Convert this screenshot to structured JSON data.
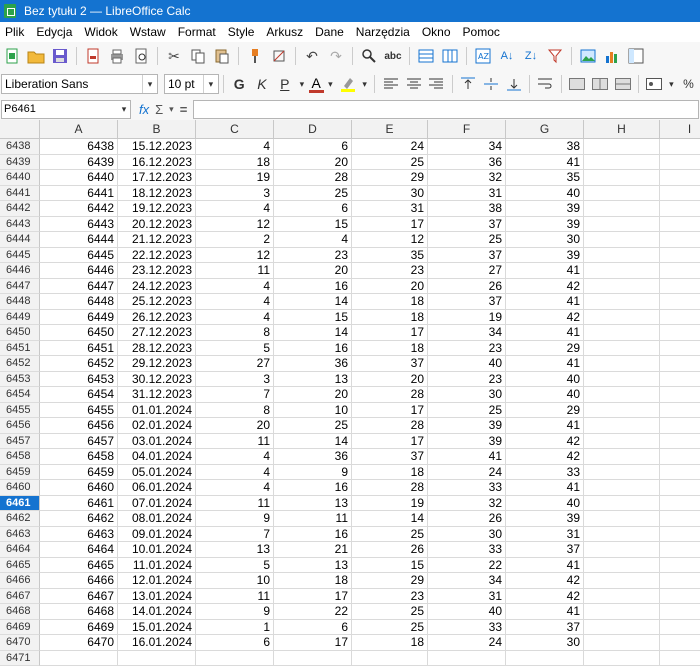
{
  "window": {
    "title": "Bez tytułu 2 — LibreOffice Calc"
  },
  "menu": [
    "Plik",
    "Edycja",
    "Widok",
    "Wstaw",
    "Format",
    "Style",
    "Arkusz",
    "Dane",
    "Narzędzia",
    "Okno",
    "Pomoc"
  ],
  "format": {
    "font_name": "Liberation Sans",
    "font_size": "10 pt",
    "bold": "G",
    "italic": "K",
    "underline": "P",
    "font_color_letter": "A"
  },
  "formula": {
    "cell_ref": "P6461",
    "fx": "fx",
    "sigma": "Σ",
    "equals": "=",
    "content": ""
  },
  "columns": [
    "A",
    "B",
    "C",
    "D",
    "E",
    "F",
    "G",
    "H",
    "I"
  ],
  "active_row": "6461",
  "rows": [
    {
      "n": "6438",
      "a": "6438",
      "b": "15.12.2023",
      "c": "4",
      "d": "6",
      "e": "24",
      "f": "34",
      "g": "38"
    },
    {
      "n": "6439",
      "a": "6439",
      "b": "16.12.2023",
      "c": "18",
      "d": "20",
      "e": "25",
      "f": "36",
      "g": "41"
    },
    {
      "n": "6440",
      "a": "6440",
      "b": "17.12.2023",
      "c": "19",
      "d": "28",
      "e": "29",
      "f": "32",
      "g": "35"
    },
    {
      "n": "6441",
      "a": "6441",
      "b": "18.12.2023",
      "c": "3",
      "d": "25",
      "e": "30",
      "f": "31",
      "g": "40"
    },
    {
      "n": "6442",
      "a": "6442",
      "b": "19.12.2023",
      "c": "4",
      "d": "6",
      "e": "31",
      "f": "38",
      "g": "39"
    },
    {
      "n": "6443",
      "a": "6443",
      "b": "20.12.2023",
      "c": "12",
      "d": "15",
      "e": "17",
      "f": "37",
      "g": "39"
    },
    {
      "n": "6444",
      "a": "6444",
      "b": "21.12.2023",
      "c": "2",
      "d": "4",
      "e": "12",
      "f": "25",
      "g": "30"
    },
    {
      "n": "6445",
      "a": "6445",
      "b": "22.12.2023",
      "c": "12",
      "d": "23",
      "e": "35",
      "f": "37",
      "g": "39"
    },
    {
      "n": "6446",
      "a": "6446",
      "b": "23.12.2023",
      "c": "11",
      "d": "20",
      "e": "23",
      "f": "27",
      "g": "41"
    },
    {
      "n": "6447",
      "a": "6447",
      "b": "24.12.2023",
      "c": "4",
      "d": "16",
      "e": "20",
      "f": "26",
      "g": "42"
    },
    {
      "n": "6448",
      "a": "6448",
      "b": "25.12.2023",
      "c": "4",
      "d": "14",
      "e": "18",
      "f": "37",
      "g": "41"
    },
    {
      "n": "6449",
      "a": "6449",
      "b": "26.12.2023",
      "c": "4",
      "d": "15",
      "e": "18",
      "f": "19",
      "g": "42"
    },
    {
      "n": "6450",
      "a": "6450",
      "b": "27.12.2023",
      "c": "8",
      "d": "14",
      "e": "17",
      "f": "34",
      "g": "41"
    },
    {
      "n": "6451",
      "a": "6451",
      "b": "28.12.2023",
      "c": "5",
      "d": "16",
      "e": "18",
      "f": "23",
      "g": "29"
    },
    {
      "n": "6452",
      "a": "6452",
      "b": "29.12.2023",
      "c": "27",
      "d": "36",
      "e": "37",
      "f": "40",
      "g": "41"
    },
    {
      "n": "6453",
      "a": "6453",
      "b": "30.12.2023",
      "c": "3",
      "d": "13",
      "e": "20",
      "f": "23",
      "g": "40"
    },
    {
      "n": "6454",
      "a": "6454",
      "b": "31.12.2023",
      "c": "7",
      "d": "20",
      "e": "28",
      "f": "30",
      "g": "40"
    },
    {
      "n": "6455",
      "a": "6455",
      "b": "01.01.2024",
      "c": "8",
      "d": "10",
      "e": "17",
      "f": "25",
      "g": "29"
    },
    {
      "n": "6456",
      "a": "6456",
      "b": "02.01.2024",
      "c": "20",
      "d": "25",
      "e": "28",
      "f": "39",
      "g": "41"
    },
    {
      "n": "6457",
      "a": "6457",
      "b": "03.01.2024",
      "c": "11",
      "d": "14",
      "e": "17",
      "f": "39",
      "g": "42"
    },
    {
      "n": "6458",
      "a": "6458",
      "b": "04.01.2024",
      "c": "4",
      "d": "36",
      "e": "37",
      "f": "41",
      "g": "42"
    },
    {
      "n": "6459",
      "a": "6459",
      "b": "05.01.2024",
      "c": "4",
      "d": "9",
      "e": "18",
      "f": "24",
      "g": "33"
    },
    {
      "n": "6460",
      "a": "6460",
      "b": "06.01.2024",
      "c": "4",
      "d": "16",
      "e": "28",
      "f": "33",
      "g": "41"
    },
    {
      "n": "6461",
      "a": "6461",
      "b": "07.01.2024",
      "c": "11",
      "d": "13",
      "e": "19",
      "f": "32",
      "g": "40"
    },
    {
      "n": "6462",
      "a": "6462",
      "b": "08.01.2024",
      "c": "9",
      "d": "11",
      "e": "14",
      "f": "26",
      "g": "39"
    },
    {
      "n": "6463",
      "a": "6463",
      "b": "09.01.2024",
      "c": "7",
      "d": "16",
      "e": "25",
      "f": "30",
      "g": "31"
    },
    {
      "n": "6464",
      "a": "6464",
      "b": "10.01.2024",
      "c": "13",
      "d": "21",
      "e": "26",
      "f": "33",
      "g": "37"
    },
    {
      "n": "6465",
      "a": "6465",
      "b": "11.01.2024",
      "c": "5",
      "d": "13",
      "e": "15",
      "f": "22",
      "g": "41"
    },
    {
      "n": "6466",
      "a": "6466",
      "b": "12.01.2024",
      "c": "10",
      "d": "18",
      "e": "29",
      "f": "34",
      "g": "42"
    },
    {
      "n": "6467",
      "a": "6467",
      "b": "13.01.2024",
      "c": "11",
      "d": "17",
      "e": "23",
      "f": "31",
      "g": "42"
    },
    {
      "n": "6468",
      "a": "6468",
      "b": "14.01.2024",
      "c": "9",
      "d": "22",
      "e": "25",
      "f": "40",
      "g": "41"
    },
    {
      "n": "6469",
      "a": "6469",
      "b": "15.01.2024",
      "c": "1",
      "d": "6",
      "e": "25",
      "f": "33",
      "g": "37"
    },
    {
      "n": "6470",
      "a": "6470",
      "b": "16.01.2024",
      "c": "6",
      "d": "17",
      "e": "18",
      "f": "24",
      "g": "30"
    },
    {
      "n": "6471",
      "a": "",
      "b": "",
      "c": "",
      "d": "",
      "e": "",
      "f": "",
      "g": ""
    }
  ],
  "colors": {
    "titlebar": "#1473d0",
    "active_row_header": "#1473d0",
    "calc_green": "#2ca24b"
  }
}
